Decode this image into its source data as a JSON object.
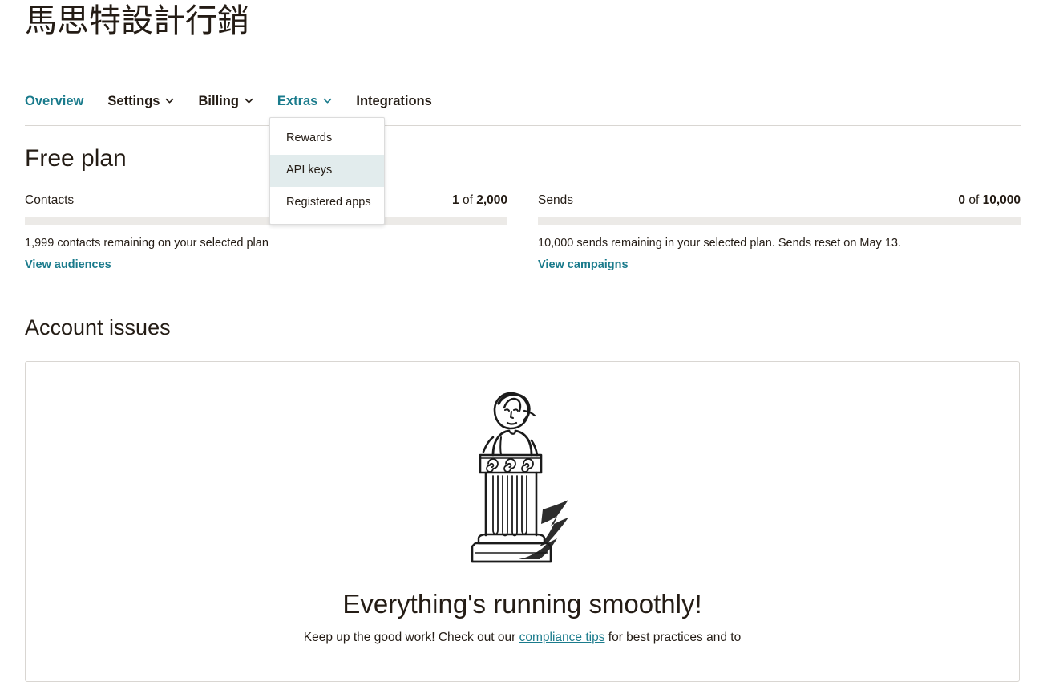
{
  "account": {
    "name": "馬思特設計行銷"
  },
  "nav": {
    "items": [
      {
        "label": "Overview",
        "active": true,
        "has_caret": false,
        "icon": ""
      },
      {
        "label": "Settings",
        "active": false,
        "has_caret": true,
        "icon": "chevron-down-icon"
      },
      {
        "label": "Billing",
        "active": false,
        "has_caret": true,
        "icon": "chevron-down-icon"
      },
      {
        "label": "Extras",
        "active": true,
        "has_caret": true,
        "icon": "chevron-down-icon"
      },
      {
        "label": "Integrations",
        "active": false,
        "has_caret": false,
        "icon": ""
      }
    ]
  },
  "dropdown": {
    "owner": "Extras",
    "items": [
      {
        "label": "Rewards",
        "highlighted": false
      },
      {
        "label": "API keys",
        "highlighted": true
      },
      {
        "label": "Registered apps",
        "highlighted": false
      }
    ]
  },
  "plan": {
    "title": "Free plan",
    "meters": [
      {
        "label": "Contacts",
        "used": "1",
        "of": "of",
        "total": "2,000",
        "percent": 0,
        "note": "1,999 contacts remaining on your selected plan",
        "link": "View audiences"
      },
      {
        "label": "Sends",
        "used": "0",
        "of": "of",
        "total": "10,000",
        "percent": 0,
        "note": "10,000 sends remaining in your selected plan. Sends reset on May 13.",
        "link": "View campaigns"
      }
    ]
  },
  "account_issues": {
    "title": "Account issues",
    "illustration": "statue-on-column-illustration",
    "heading": "Everything's running smoothly!",
    "sub_before": "Keep up the good work! Check out our ",
    "sub_link": "compliance tips",
    "sub_after": " for best practices and to"
  },
  "colors": {
    "accent_teal": "#1a7b8c",
    "text_dark": "#241c15",
    "rule": "#d9d6d2",
    "meter_track": "#eceae7",
    "dropdown_highlight": "#e2eced"
  }
}
